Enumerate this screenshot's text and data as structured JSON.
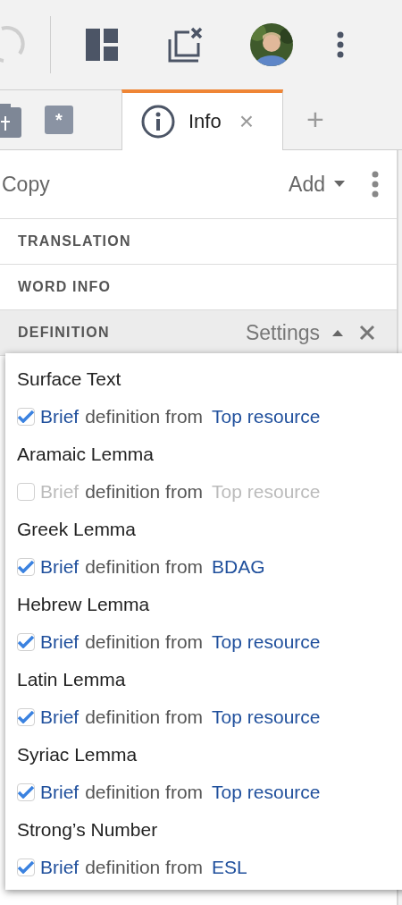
{
  "tabs": [
    {
      "kind": "clipboard",
      "selected": false
    },
    {
      "kind": "asterisk",
      "label": "*",
      "selected": false
    },
    {
      "kind": "info",
      "label": "Info",
      "close": "×",
      "selected": true
    }
  ],
  "add_tab": "+",
  "panel_toolbar": {
    "copy": "Copy",
    "add": "Add"
  },
  "sections": [
    {
      "title": "TRANSLATION"
    },
    {
      "title": "WORD INFO"
    },
    {
      "title": "DEFINITION",
      "expanded": true,
      "settings": "Settings"
    }
  ],
  "settings_menu": [
    {
      "heading": "Surface Text",
      "brief": "Brief",
      "middle": "definition from",
      "source": "Top resource",
      "checked": true
    },
    {
      "heading": "Aramaic Lemma",
      "brief": "Brief",
      "middle": "definition from",
      "source": "Top resource",
      "checked": false
    },
    {
      "heading": "Greek Lemma",
      "brief": "Brief",
      "middle": "definition from",
      "source": "BDAG",
      "checked": true
    },
    {
      "heading": "Hebrew Lemma",
      "brief": "Brief",
      "middle": "definition from",
      "source": "Top resource",
      "checked": true
    },
    {
      "heading": "Latin Lemma",
      "brief": "Brief",
      "middle": "definition from",
      "source": "Top resource",
      "checked": true
    },
    {
      "heading": "Syriac Lemma",
      "brief": "Brief",
      "middle": "definition from",
      "source": "Top resource",
      "checked": true
    },
    {
      "heading": "Strong’s Number",
      "brief": "Brief",
      "middle": "definition from",
      "source": "ESL",
      "checked": true
    }
  ]
}
